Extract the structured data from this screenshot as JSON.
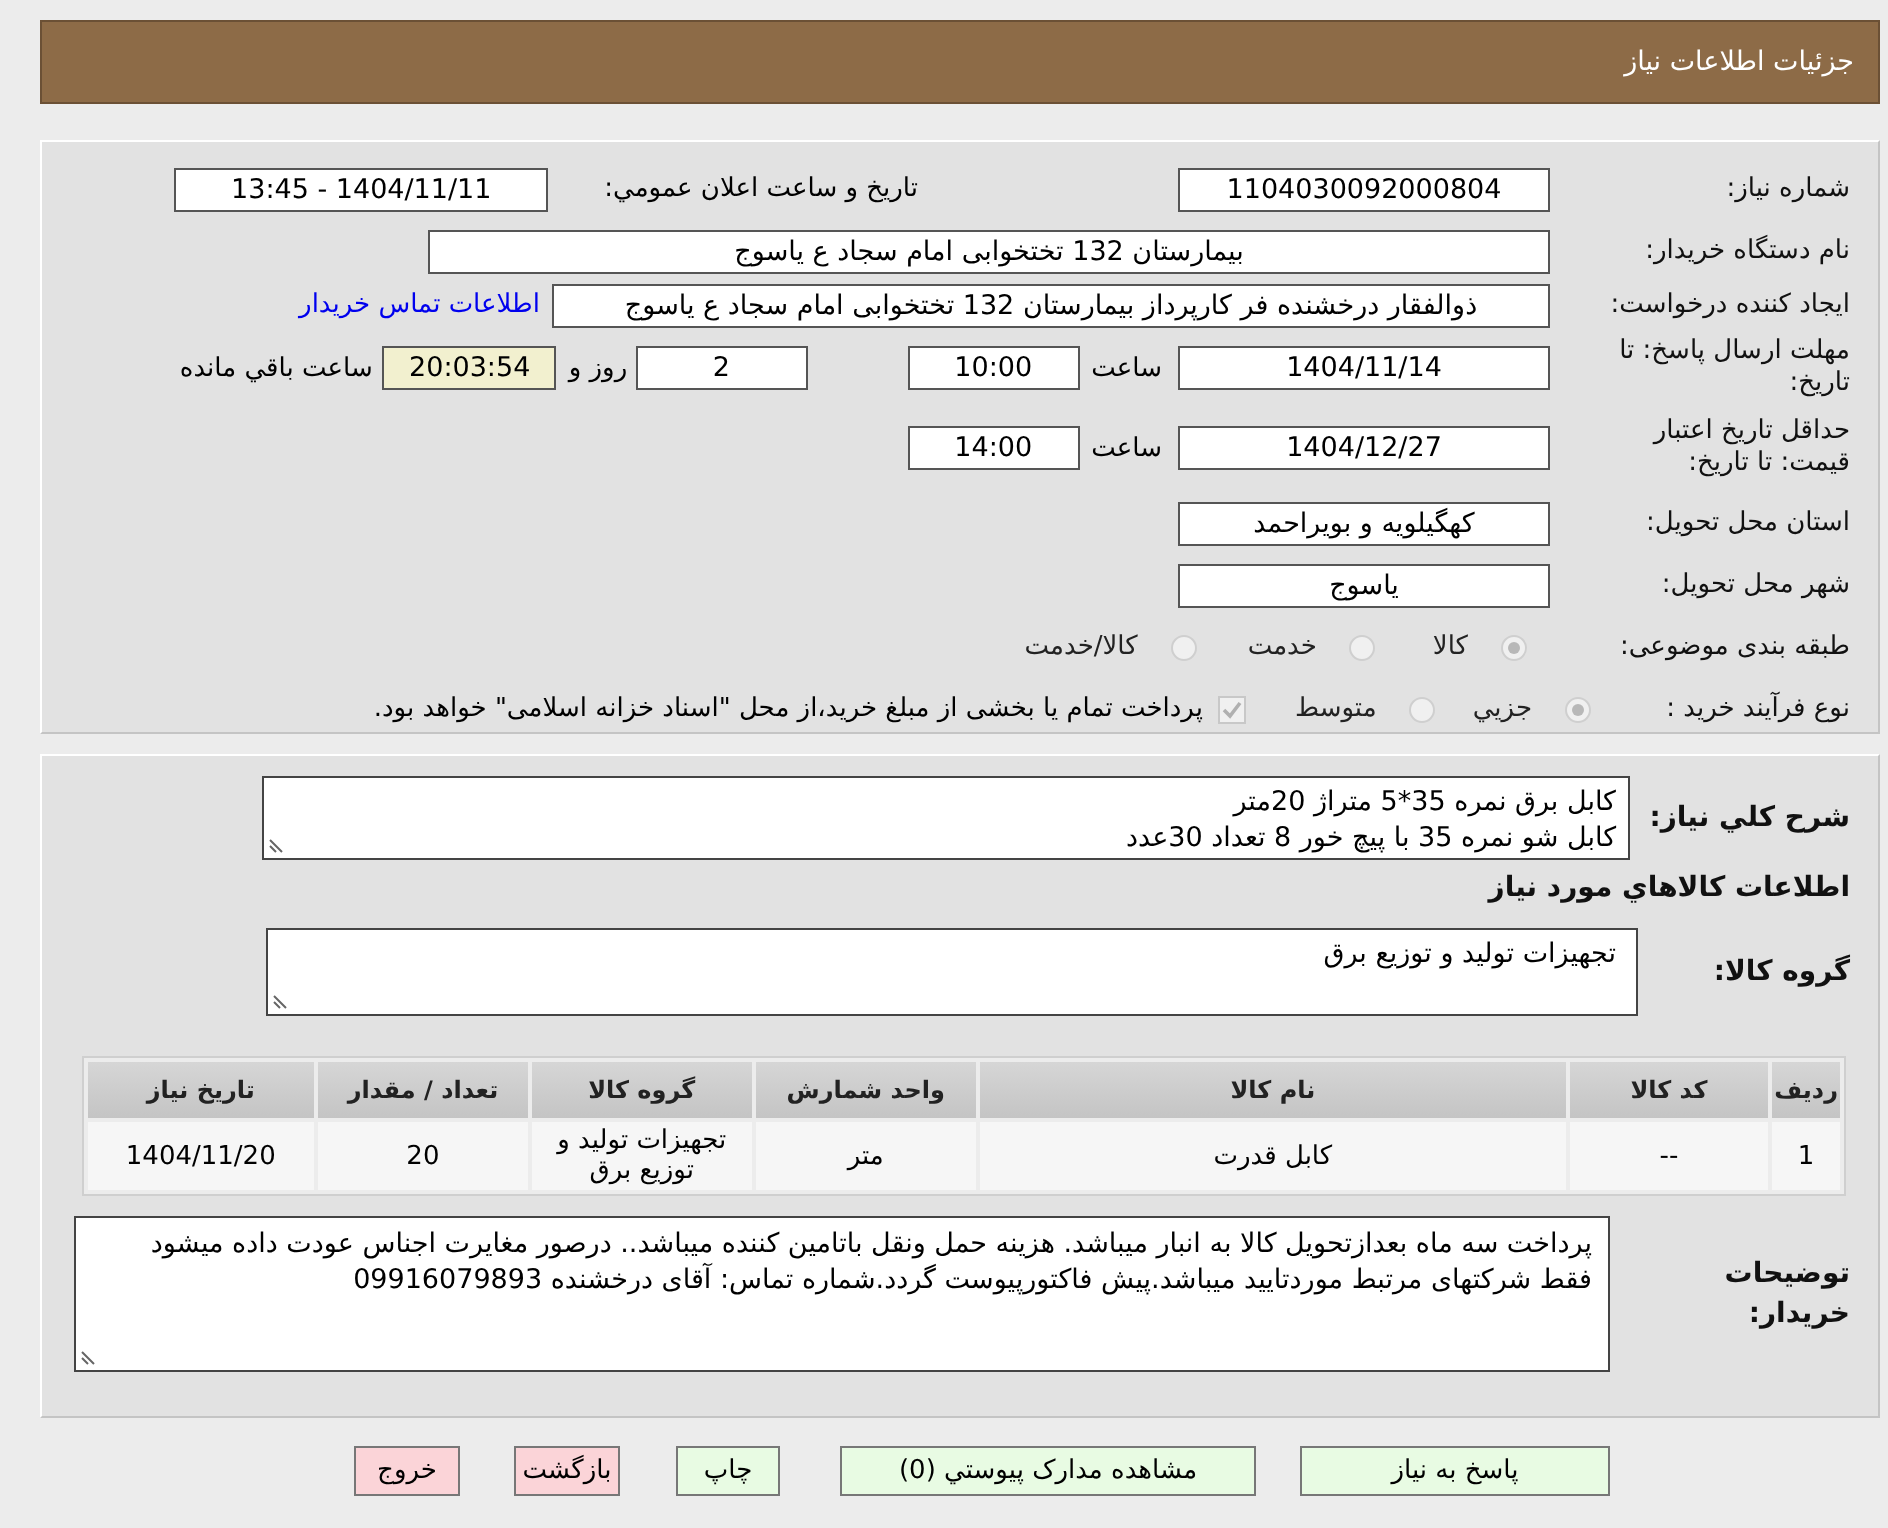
{
  "header": {
    "title": "جزئیات اطلاعات نیاز"
  },
  "need_info": {
    "need_number": {
      "label": "شماره نیاز:",
      "value": "1104030092000804"
    },
    "announce_datetime": {
      "label": "تاریخ و ساعت اعلان عمومي:",
      "value": "1404/11/11 - 13:45"
    },
    "buyer_org": {
      "label": "نام دستگاه خریدار:",
      "value": "بیمارستان 132 تختخوابی امام سجاد  ع  یاسوج"
    },
    "requester": {
      "label": "ایجاد کننده درخواست:",
      "value": "ذوالفقار درخشنده فر کارپرداز بیمارستان 132 تختخوابی امام سجاد  ع  یاسوج",
      "contact_link": "اطلاعات تماس خریدار"
    },
    "reply_deadline": {
      "label": "مهلت ارسال پاسخ: تا تاریخ:",
      "date": "1404/11/14",
      "time_label": "ساعت",
      "time": "10:00",
      "days": "2",
      "days_label": "روز و",
      "remaining": "20:03:54",
      "remaining_label": "ساعت باقي مانده"
    },
    "price_validity": {
      "label": "حداقل تاریخ اعتبار قیمت: تا تاریخ:",
      "date": "1404/12/27",
      "time_label": "ساعت",
      "time": "14:00"
    },
    "delivery_province": {
      "label": "استان محل تحویل:",
      "value": "کهگیلویه و بویراحمد"
    },
    "delivery_city": {
      "label": "شهر محل تحویل:",
      "value": "یاسوج"
    },
    "category": {
      "label": "طبقه بندی موضوعی:",
      "disabled": true,
      "options": [
        {
          "label": "کالا",
          "selected": true
        },
        {
          "label": "خدمت",
          "selected": false
        },
        {
          "label": "کالا/خدمت",
          "selected": false
        }
      ]
    },
    "purchase_process": {
      "label": "نوع فرآیند خرید :",
      "disabled": true,
      "options": [
        {
          "label": "جزيي",
          "selected": true
        },
        {
          "label": "متوسط",
          "selected": false
        }
      ],
      "payment_note": {
        "checked": true,
        "disabled": true,
        "text": "پرداخت تمام یا بخشی از مبلغ خرید،از محل \"اسناد خزانه اسلامی\" خواهد بود."
      }
    }
  },
  "goods": {
    "description": {
      "label": "شرح کلي نیاز:",
      "value": "کابل برق نمره 35*5 متراژ 20متر\nکابل شو نمره 35 با پیچ خور 8 تعداد 30عدد"
    },
    "heading": "اطلاعات کالاهاي مورد نیاز",
    "group": {
      "label": "گروه کالا:",
      "value": "تجهیزات تولید و توزیع برق"
    },
    "table": {
      "columns": [
        "ردیف",
        "کد کالا",
        "نام کالا",
        "واحد شمارش",
        "گروه کالا",
        "تعداد / مقدار",
        "تاریخ نیاز"
      ],
      "rows": [
        [
          "1",
          "--",
          "کابل قدرت",
          "متر",
          "تجهیزات تولید و توزیع برق",
          "20",
          "1404/11/20"
        ]
      ]
    },
    "buyer_notes": {
      "label": "توضیحات خریدار:",
      "value": "پرداخت سه ماه بعدازتحویل کالا به انبار میباشد. هزینه حمل ونقل باتامین کننده میباشد.. درصور مغایرت اجناس عودت داده میشود فقط شرکتهای مرتبط موردتایید میباشد.پیش فاکتورپیوست گردد.شماره تماس: آقای درخشنده 09916079893"
    }
  },
  "buttons": [
    {
      "label": "پاسخ به نیاز",
      "kind": "action"
    },
    {
      "label": "مشاهده مدارک پیوستي (0)",
      "kind": "action"
    },
    {
      "label": "چاپ",
      "kind": "action"
    },
    {
      "label": "بازگشت",
      "kind": "exit"
    },
    {
      "label": "خروج",
      "kind": "exit"
    }
  ]
}
